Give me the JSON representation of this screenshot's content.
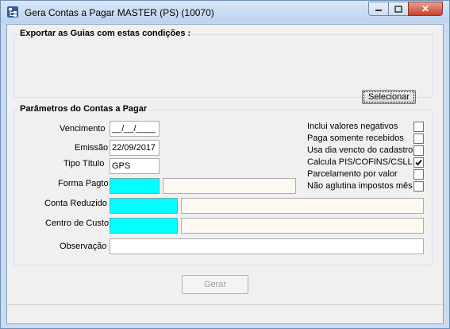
{
  "window": {
    "title": "Gera Contas a Pagar MASTER (PS) (10070)",
    "icons": {
      "app": "app-tree-icon",
      "minimize": "minimize-icon",
      "maximize": "maximize-icon",
      "close": "close-icon"
    },
    "close_glyph": "✕"
  },
  "export_group": {
    "legend": "Exportar as Guias com estas condições :",
    "select_button": "Selecionar"
  },
  "params_group": {
    "legend": "Parâmetros do Contas a Pagar",
    "vencimento_label": "Vencimento",
    "vencimento_value": "__/__/____",
    "emissao_label": "Emissão",
    "emissao_value": "22/09/2017",
    "tipo_titulo_label": "Tipo Título",
    "tipo_titulo_value": "GPS",
    "forma_pagto_label": "Forma Pagto",
    "conta_reduzido_label": "Conta Reduzido",
    "centro_custo_label": "Centro de Custo",
    "observacao_label": "Observação",
    "options": [
      {
        "label": "Inclui valores negativos",
        "checked": false
      },
      {
        "label": "Paga somente recebidos",
        "checked": false
      },
      {
        "label": "Usa dia vencto do cadastro",
        "checked": false
      },
      {
        "label": "Calcula PIS/COFINS/CSLL",
        "checked": true
      },
      {
        "label": "Parcelamento por valor",
        "checked": false
      },
      {
        "label": "Não aglutina impostos mês",
        "checked": false
      }
    ]
  },
  "actions": {
    "gerar": "Gerar"
  },
  "colors": {
    "lookup_field": "#00ffff",
    "description_field": "#fdf8f0"
  }
}
